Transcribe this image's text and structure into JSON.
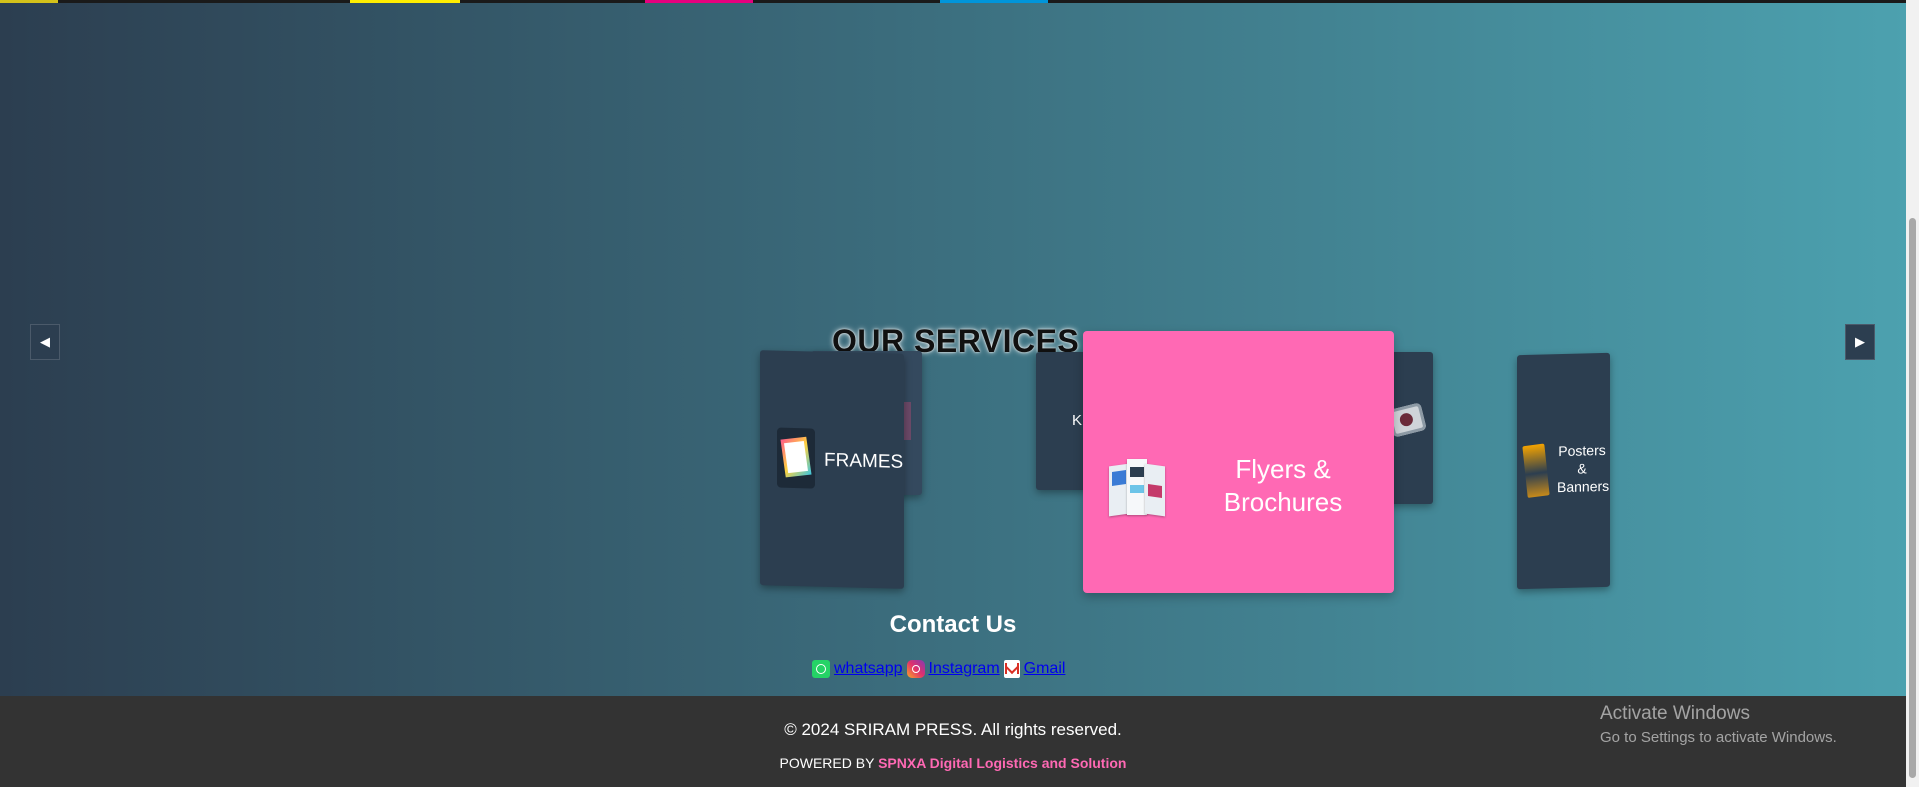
{
  "top_strip_colors": [
    "#d4c21a",
    "#111111",
    "#ffee00",
    "#111111",
    "#e6007e",
    "#111111",
    "#0095da"
  ],
  "services": {
    "title": "OUR SERVICES",
    "prev_glyph": "◀",
    "next_glyph": "▶",
    "cards": {
      "frames_label": "FRAMES",
      "active_label": "Flyers & Brochures",
      "posters_label": "Posters & Banners",
      "back_letter": "K"
    },
    "active_color": "#ff69b4"
  },
  "contact": {
    "title": "Contact Us",
    "links": [
      {
        "label": " whatsapp",
        "icon": "whatsapp-icon"
      },
      {
        "label": " Instagram",
        "icon": "instagram-icon"
      },
      {
        "label": " Gmail",
        "icon": "gmail-icon"
      }
    ]
  },
  "footer": {
    "copyright": "© 2024 SRIRAM PRESS. All rights reserved.",
    "powered_prefix": "POWERED BY",
    "powered_brand": "SPNXA Digital Logistics and Solution"
  },
  "watermark": {
    "line1": "Activate Windows",
    "line2": "Go to Settings to activate Windows."
  }
}
